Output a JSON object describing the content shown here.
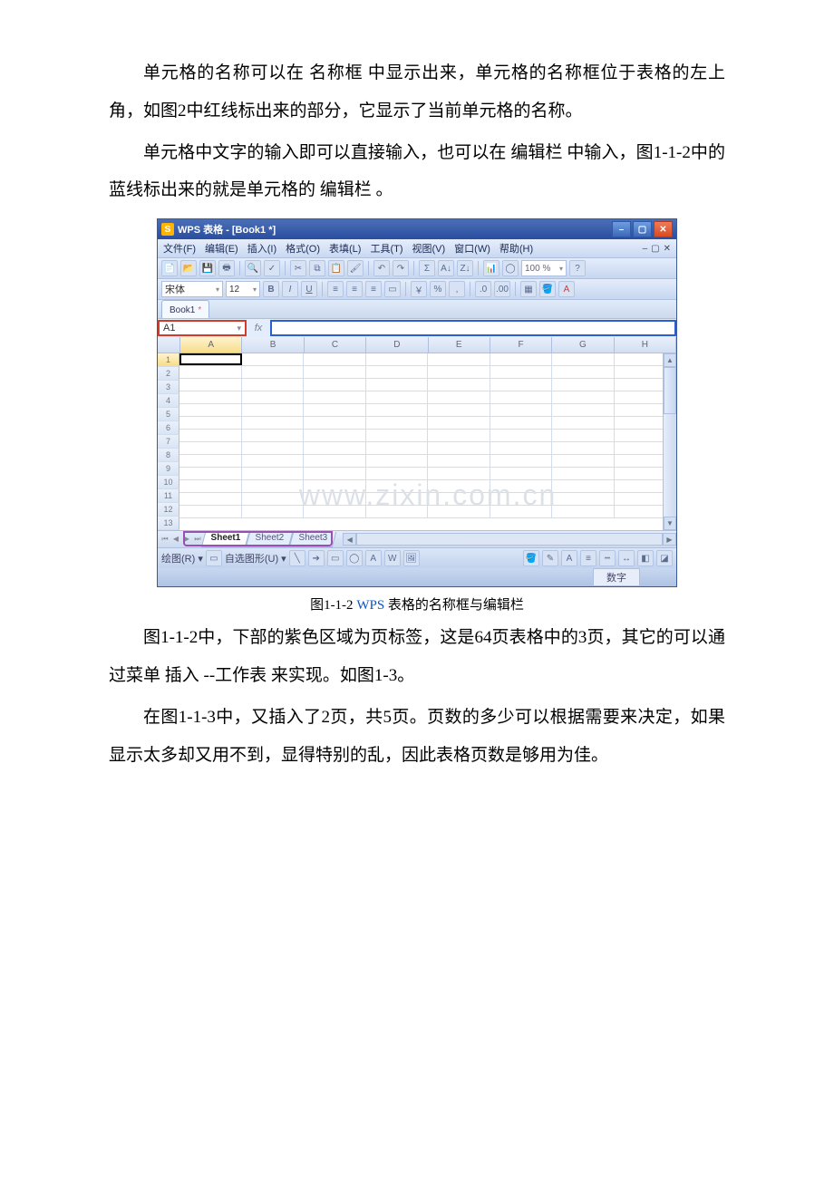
{
  "para1": "单元格的名称可以在 名称框 中显示出来，单元格的名称框位于表格的左上角，如图2中红线标出来的部分，它显示了当前单元格的名称。",
  "para2": "单元格中文字的输入即可以直接输入，也可以在 编辑栏 中输入，图1-1-2中的蓝线标出来的就是单元格的 编辑栏 。",
  "caption_prefix": "图1-1-2 ",
  "caption_link": "WPS",
  "caption_suffix": " 表格的名称框与编辑栏",
  "para3": "图1-1-2中，下部的紫色区域为页标签，这是64页表格中的3页，其它的可以通过菜单 插入 --工作表 来实现。如图1-3。",
  "para4": "在图1-1-3中，又插入了2页，共5页。页数的多少可以根据需要来决定，如果显示太多却又用不到，显得特别的乱，因此表格页数是够用为佳。",
  "app": {
    "title": "WPS 表格 - [Book1 *]",
    "logo_char": "S",
    "menus": [
      "文件(F)",
      "编辑(E)",
      "插入(I)",
      "格式(O)",
      "表填(L)",
      "工具(T)",
      "视图(V)",
      "窗口(W)",
      "帮助(H)"
    ],
    "mini_controls": [
      "–",
      "▢",
      "✕"
    ],
    "font_name": "宋体",
    "font_size": "12",
    "zoom": "100 %",
    "doc_tab": "Book1",
    "doc_tab_dot": "*",
    "name_box": "A1",
    "fx_label": "fx",
    "columns": [
      "A",
      "B",
      "C",
      "D",
      "E",
      "F",
      "G",
      "H"
    ],
    "rows": [
      "1",
      "2",
      "3",
      "4",
      "5",
      "6",
      "7",
      "8",
      "9",
      "10",
      "11",
      "12",
      "13"
    ],
    "watermark": "www.zixin.com.cn",
    "sheet_tabs": [
      "Sheet1",
      "Sheet2",
      "Sheet3"
    ],
    "tab_nav": [
      "⏮",
      "◀",
      "▶",
      "⏭"
    ],
    "draw_label": "绘图(R) ▾",
    "autoshape_label": "自选图形(U) ▾",
    "status_text": "数字"
  }
}
